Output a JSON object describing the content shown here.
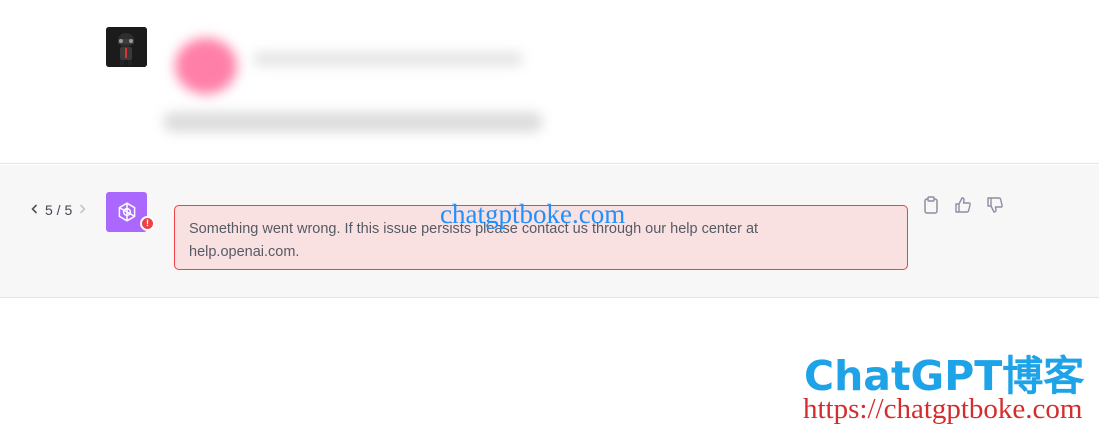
{
  "pager": {
    "prev_icon": "chevron-left-icon",
    "label": "5 / 5",
    "next_icon": "chevron-right-icon"
  },
  "assistant": {
    "avatar_icon": "openai-logo-icon",
    "avatar_color": "#ab68ff",
    "error_badge": "!",
    "error_message_line1": "Something went wrong. If this issue persists please contact us through our help center at",
    "error_message_line2": "help.openai.com.",
    "error_color": "#ef4146"
  },
  "actions": {
    "copy_icon": "clipboard-icon",
    "like_icon": "thumbs-up-icon",
    "dislike_icon": "thumbs-down-icon"
  },
  "watermarks": {
    "center": "chatgptboke.com",
    "brand": "ChatGPT博客",
    "url": "https://chatgptboke.com"
  }
}
